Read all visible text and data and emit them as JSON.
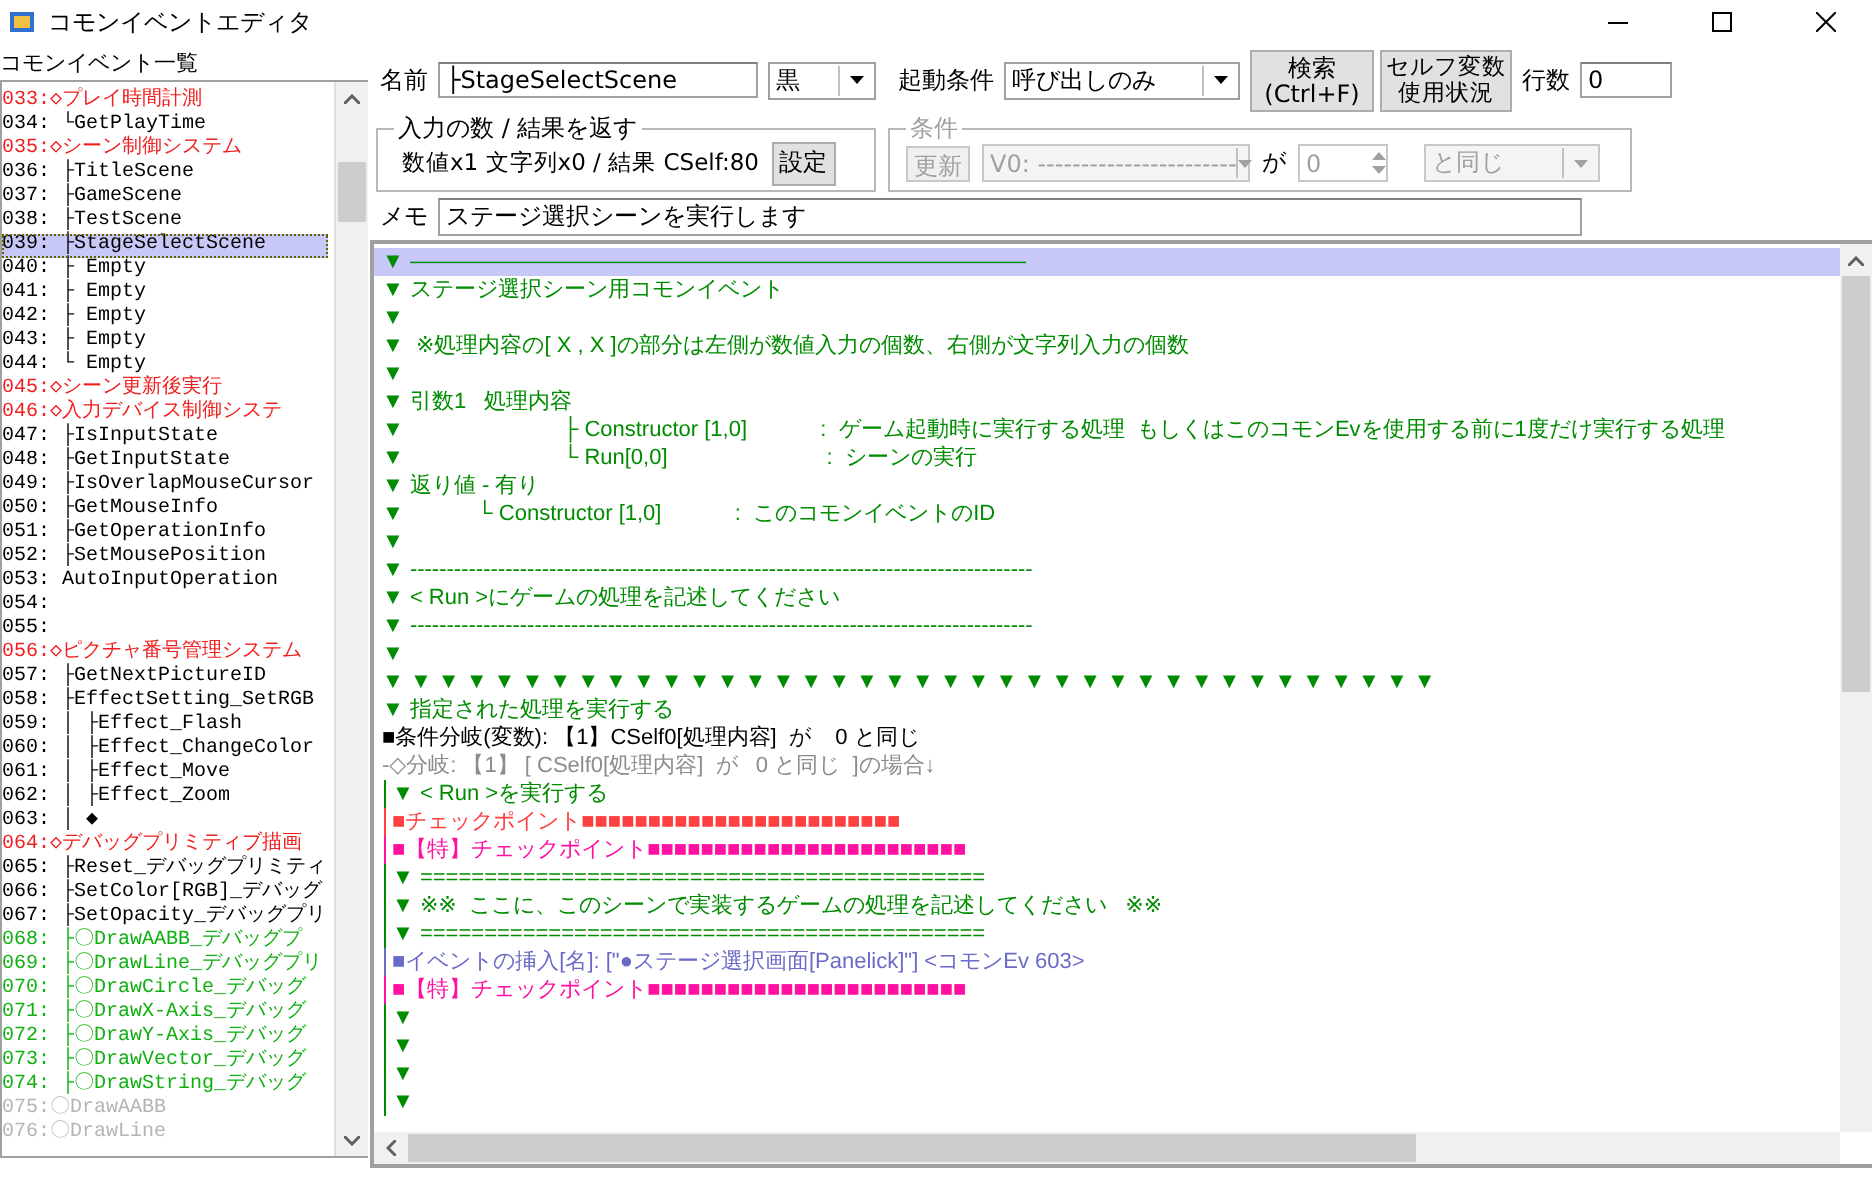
{
  "window": {
    "title": "コモンイベントエディタ"
  },
  "event_list": {
    "heading": "コモンイベント一覧",
    "items": [
      {
        "label": "033:◇プレイ時間計測",
        "color": "#f02020",
        "selected": false
      },
      {
        "label": "034: └GetPlayTime",
        "color": "#000000",
        "selected": false
      },
      {
        "label": "035:◇シーン制御システム",
        "color": "#f02020",
        "selected": false
      },
      {
        "label": "036: ├TitleScene",
        "color": "#000000",
        "selected": false
      },
      {
        "label": "037: ├GameScene",
        "color": "#000000",
        "selected": false
      },
      {
        "label": "038: ├TestScene",
        "color": "#000000",
        "selected": false
      },
      {
        "label": "039: ├StageSelectScene",
        "color": "#000000",
        "selected": true
      },
      {
        "label": "040: ├ Empty",
        "color": "#000000",
        "selected": false
      },
      {
        "label": "041: ├ Empty",
        "color": "#000000",
        "selected": false
      },
      {
        "label": "042: ├ Empty",
        "color": "#000000",
        "selected": false
      },
      {
        "label": "043: ├ Empty",
        "color": "#000000",
        "selected": false
      },
      {
        "label": "044: └ Empty",
        "color": "#000000",
        "selected": false
      },
      {
        "label": "045:◇シーン更新後実行",
        "color": "#f02020",
        "selected": false
      },
      {
        "label": "046:◇入力デバイス制御システ",
        "color": "#f02020",
        "selected": false
      },
      {
        "label": "047: ├IsInputState",
        "color": "#000000",
        "selected": false
      },
      {
        "label": "048: ├GetInputState",
        "color": "#000000",
        "selected": false
      },
      {
        "label": "049: ├IsOverlapMouseCursor",
        "color": "#000000",
        "selected": false
      },
      {
        "label": "050: ├GetMouseInfo",
        "color": "#000000",
        "selected": false
      },
      {
        "label": "051: ├GetOperationInfo",
        "color": "#000000",
        "selected": false
      },
      {
        "label": "052: ├SetMousePosition",
        "color": "#000000",
        "selected": false
      },
      {
        "label": "053: AutoInputOperation",
        "color": "#000000",
        "selected": false
      },
      {
        "label": "054:",
        "color": "#000000",
        "selected": false
      },
      {
        "label": "055:",
        "color": "#000000",
        "selected": false
      },
      {
        "label": "056:◇ピクチャ番号管理システム",
        "color": "#f02020",
        "selected": false
      },
      {
        "label": "057: ├GetNextPictureID",
        "color": "#000000",
        "selected": false
      },
      {
        "label": "058: ├EffectSetting_SetRGB",
        "color": "#000000",
        "selected": false
      },
      {
        "label": "059: │ ├Effect_Flash",
        "color": "#000000",
        "selected": false
      },
      {
        "label": "060: │ ├Effect_ChangeColor",
        "color": "#000000",
        "selected": false
      },
      {
        "label": "061: │ ├Effect_Move",
        "color": "#000000",
        "selected": false
      },
      {
        "label": "062: │ ├Effect_Zoom",
        "color": "#000000",
        "selected": false
      },
      {
        "label": "063: │ ◆",
        "color": "#000000",
        "selected": false
      },
      {
        "label": "064:◇デバッグプリミティブ描画",
        "color": "#f02020",
        "selected": false
      },
      {
        "label": "065: ├Reset_デバッグプリミティ",
        "color": "#000000",
        "selected": false
      },
      {
        "label": "066: ├SetColor[RGB]_デバッグ",
        "color": "#000000",
        "selected": false
      },
      {
        "label": "067: ├SetOpacity_デバッグプリ",
        "color": "#000000",
        "selected": false
      },
      {
        "label": "068: ├〇DrawAABB_デバッグプ",
        "color": "#10b010",
        "selected": false
      },
      {
        "label": "069: ├〇DrawLine_デバッグプリ",
        "color": "#10b010",
        "selected": false
      },
      {
        "label": "070: ├〇DrawCircle_デバッグ",
        "color": "#10b010",
        "selected": false
      },
      {
        "label": "071: ├〇DrawX-Axis_デバッグ",
        "color": "#10b010",
        "selected": false
      },
      {
        "label": "072: ├〇DrawY-Axis_デバッグ",
        "color": "#10b010",
        "selected": false
      },
      {
        "label": "073: ├〇DrawVector_デバッグ",
        "color": "#10b010",
        "selected": false
      },
      {
        "label": "074: ├〇DrawString_デバッグ",
        "color": "#10b010",
        "selected": false
      },
      {
        "label": "075:〇DrawAABB",
        "color": "#b4b4b4",
        "selected": false
      },
      {
        "label": "076:〇DrawLine",
        "color": "#b4b4b4",
        "selected": false
      }
    ]
  },
  "name_field": {
    "label": "名前",
    "value": "├StageSelectScene"
  },
  "color_select": {
    "value": "黒"
  },
  "trigger": {
    "label": "起動条件",
    "value": "呼び出しのみ"
  },
  "search_button": {
    "label": "検索\n(Ctrl+F)"
  },
  "self_var_button": {
    "lines": [
      "セルフ変数",
      "使用状況"
    ]
  },
  "line_count": {
    "label": "行数",
    "value": "0"
  },
  "io_group": {
    "title": "入力の数 / 結果を返す",
    "summary": "数値x1 文字列x0 / 結果 CSelf:80",
    "button": "設定"
  },
  "condition_group": {
    "title": "条件",
    "disabled": true,
    "update_button": "更新",
    "variable": "V0: -----------------------",
    "particle": "が",
    "value": "0",
    "comparison": "と同じ"
  },
  "memo": {
    "label": "メモ",
    "value": "ステージ選択シーンを実行します"
  },
  "code_lines": [
    {
      "text": "▼ ――――――――――――――――――――――――――――",
      "color": "#008c00",
      "nested": false,
      "selected": true
    },
    {
      "text": "▼ ステージ選択シーン用コモンイベント",
      "color": "#008c00",
      "nested": false,
      "selected": false
    },
    {
      "text": "▼",
      "color": "#008c00",
      "nested": false,
      "selected": false
    },
    {
      "text": "▼  ※処理内容の[ X , X ]の部分は左側が数値入力の個数、右側が文字列入力の個数",
      "color": "#008c00",
      "nested": false,
      "selected": false
    },
    {
      "text": "▼",
      "color": "#008c00",
      "nested": false,
      "selected": false
    },
    {
      "text": "▼ 引数1   処理内容",
      "color": "#008c00",
      "nested": false,
      "selected": false
    },
    {
      "text": "▼                          ├ Constructor [1,0]            :  ゲーム起動時に実行する処理  もしくはこのコモンEvを使用する前に1度だけ実行する処理",
      "color": "#008c00",
      "nested": false,
      "selected": false
    },
    {
      "text": "▼                          └ Run[0,0]                          :  シーンの実行",
      "color": "#008c00",
      "nested": false,
      "selected": false
    },
    {
      "text": "▼ 返り値 - 有り",
      "color": "#008c00",
      "nested": false,
      "selected": false
    },
    {
      "text": "▼            └ Constructor [1,0]            :  このコモンイベントのID",
      "color": "#008c00",
      "nested": false,
      "selected": false
    },
    {
      "text": "▼",
      "color": "#008c00",
      "nested": false,
      "selected": false
    },
    {
      "text": "▼ -------------------------------------------------------------------------------------",
      "color": "#008c00",
      "nested": false,
      "selected": false
    },
    {
      "text": "▼ < Run >にゲームの処理を記述してください",
      "color": "#008c00",
      "nested": false,
      "selected": false
    },
    {
      "text": "▼ -------------------------------------------------------------------------------------",
      "color": "#008c00",
      "nested": false,
      "selected": false
    },
    {
      "text": "▼",
      "color": "#008c00",
      "nested": false,
      "selected": false
    },
    {
      "text": "▼ ▼ ▼ ▼ ▼ ▼ ▼ ▼ ▼ ▼ ▼ ▼ ▼ ▼ ▼ ▼ ▼ ▼ ▼ ▼ ▼ ▼ ▼ ▼ ▼ ▼ ▼ ▼ ▼ ▼ ▼ ▼ ▼ ▼ ▼ ▼ ▼ ▼",
      "color": "#008c00",
      "nested": false,
      "selected": false
    },
    {
      "text": "▼ 指定された処理を実行する",
      "color": "#008c00",
      "nested": false,
      "selected": false
    },
    {
      "text": "■条件分岐(変数): 【1】CSelf0[処理内容]  が    0 と同じ",
      "color": "#000000",
      "nested": false,
      "selected": false
    },
    {
      "text": "-◇分岐: 【1】 [ CSelf0[処理内容]  が   0 と同じ  ]の場合↓",
      "color": "#8c8c8c",
      "nested": false,
      "selected": false
    },
    {
      "text": "▼ < Run >を実行する",
      "color": "#008c00",
      "nested": true,
      "selected": false
    },
    {
      "text": "■チェックポイント■■■■■■■■■■■■■■■■■■■■■■■■",
      "color": "#ff4040",
      "nested": true,
      "selected": false
    },
    {
      "text": "■【特】チェックポイント■■■■■■■■■■■■■■■■■■■■■■■■",
      "color": "#ff10a0",
      "nested": true,
      "selected": false
    },
    {
      "text": "▼ ============================================",
      "color": "#008c00",
      "nested": true,
      "selected": false
    },
    {
      "text": "▼ ※※  ここに、このシーンで実装するゲームの処理を記述してください   ※※",
      "color": "#008c00",
      "nested": true,
      "selected": false
    },
    {
      "text": "▼ ============================================",
      "color": "#008c00",
      "nested": true,
      "selected": false
    },
    {
      "text": "■イベントの挿入[名]: [\"●ステージ選択画面[Panelick]\"] <コモンEv 603>",
      "color": "#6a6ac8",
      "nested": true,
      "selected": false
    },
    {
      "text": "■【特】チェックポイント■■■■■■■■■■■■■■■■■■■■■■■■",
      "color": "#ff10a0",
      "nested": true,
      "selected": false
    },
    {
      "text": "▼",
      "color": "#008c00",
      "nested": true,
      "selected": false
    },
    {
      "text": "▼",
      "color": "#008c00",
      "nested": true,
      "selected": false
    },
    {
      "text": "▼",
      "color": "#008c00",
      "nested": true,
      "selected": false
    },
    {
      "text": "▼",
      "color": "#008c00",
      "nested": true,
      "selected": false
    }
  ]
}
